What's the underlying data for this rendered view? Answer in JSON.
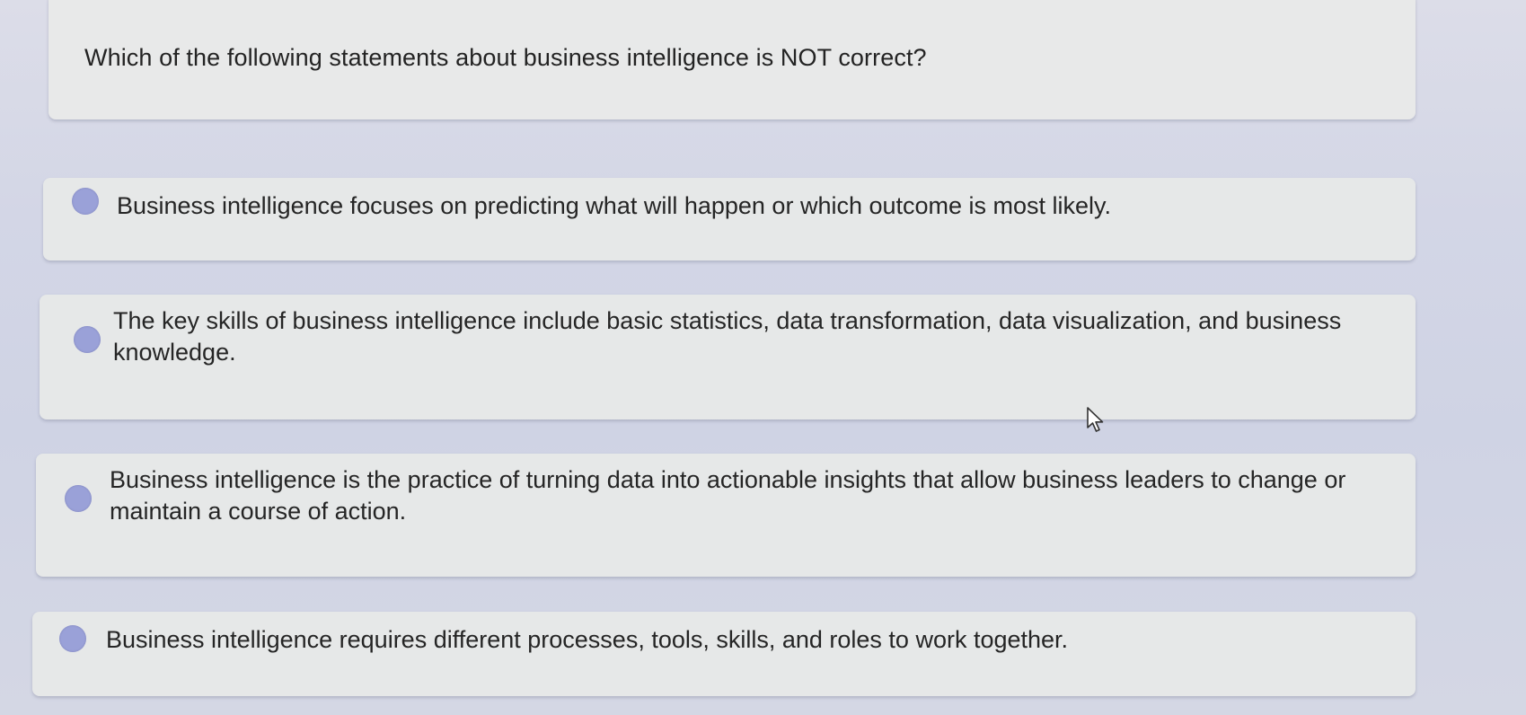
{
  "question": {
    "text": "Which of the following statements about business intelligence is NOT correct?"
  },
  "options": [
    {
      "label": "Business intelligence focuses on predicting what will happen or which outcome is most likely.",
      "selected": false
    },
    {
      "label": "The key skills of business intelligence include basic statistics, data transformation, data visualization, and business knowledge.",
      "selected": false
    },
    {
      "label": "Business intelligence is the practice of turning data into actionable insights that allow business leaders to change or maintain a course of action.",
      "selected": false
    },
    {
      "label": "Business intelligence requires different processes, tools, skills, and roles to work together.",
      "selected": false
    }
  ],
  "colors": {
    "radio": "#9aa1d8",
    "panel": "#e8e9e9",
    "background": "#d3d6e6"
  },
  "icons": {
    "cursor": "mouse-pointer-icon"
  }
}
